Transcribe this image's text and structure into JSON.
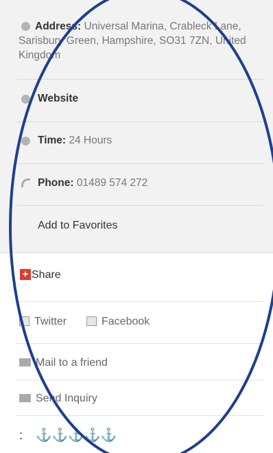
{
  "details": {
    "address_label": "Address:",
    "address_value": "Universal Marina, Crableck Lane, Sarisbury Green, Hampshire, SO31 7ZN, United Kingdom",
    "website_label": "Website",
    "time_label": "Time:",
    "time_value": "24 Hours",
    "phone_label": "Phone:",
    "phone_value": "01489 574 272",
    "favorites_label": "Add to Favorites"
  },
  "social": {
    "share_label": "Share",
    "twitter_label": "Twitter",
    "facebook_label": "Facebook",
    "mail_label": "Mail to a friend",
    "inquiry_label": "Send Inquiry"
  },
  "rating": {
    "prefix": ":",
    "anchors": "⚓⚓⚓⚓⚓",
    "value": 5,
    "max": 5
  },
  "colors": {
    "panel_bg": "#f2f2f2",
    "ellipse_stroke": "#1f3f8f",
    "share_icon": "#e03b2b",
    "anchor": "#b88a1a"
  }
}
